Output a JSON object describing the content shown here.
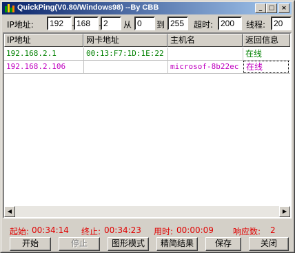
{
  "window": {
    "title": "QuickPing(V0.80/Windows98) --By CBB",
    "minimize_glyph": "_",
    "maximize_glyph": "□",
    "close_glyph": "×"
  },
  "toolbar": {
    "ip_label": "IP地址:",
    "ip1": "192",
    "ip2": "168",
    "ip3": "2",
    "dot": ".",
    "from_label": "从",
    "from_value": "0",
    "to_label": "到",
    "to_value": "255",
    "timeout_label": "超时:",
    "timeout_value": "200",
    "threads_label": "线程:",
    "threads_value": "20"
  },
  "table": {
    "columns": [
      "IP地址",
      "网卡地址",
      "主机名",
      "返回信息"
    ],
    "rows": [
      {
        "ip": "192.168.2.1",
        "mac": "00:13:F7:1D:1E:22",
        "host": "",
        "status": "在线",
        "color": "#008000"
      },
      {
        "ip": "192.168.2.106",
        "mac": "",
        "host": "microsof-8b22ec",
        "status": "在线",
        "color": "#c000c0"
      }
    ]
  },
  "status": {
    "start_label": "起始:",
    "start_time": "00:34:14",
    "end_label": "终止:",
    "end_time": "00:34:23",
    "elapsed_label": "用时:",
    "elapsed_time": "00:00:09",
    "responses_label": "响应数:",
    "responses": "2"
  },
  "buttons": {
    "start": "开始",
    "stop": "停止",
    "graph": "图形模式",
    "summary": "精简结果",
    "save": "保存",
    "close": "关闭"
  },
  "colors": {
    "titlebar_start": "#0a246a",
    "titlebar_end": "#a6caf0",
    "status_red": "#e00000"
  }
}
